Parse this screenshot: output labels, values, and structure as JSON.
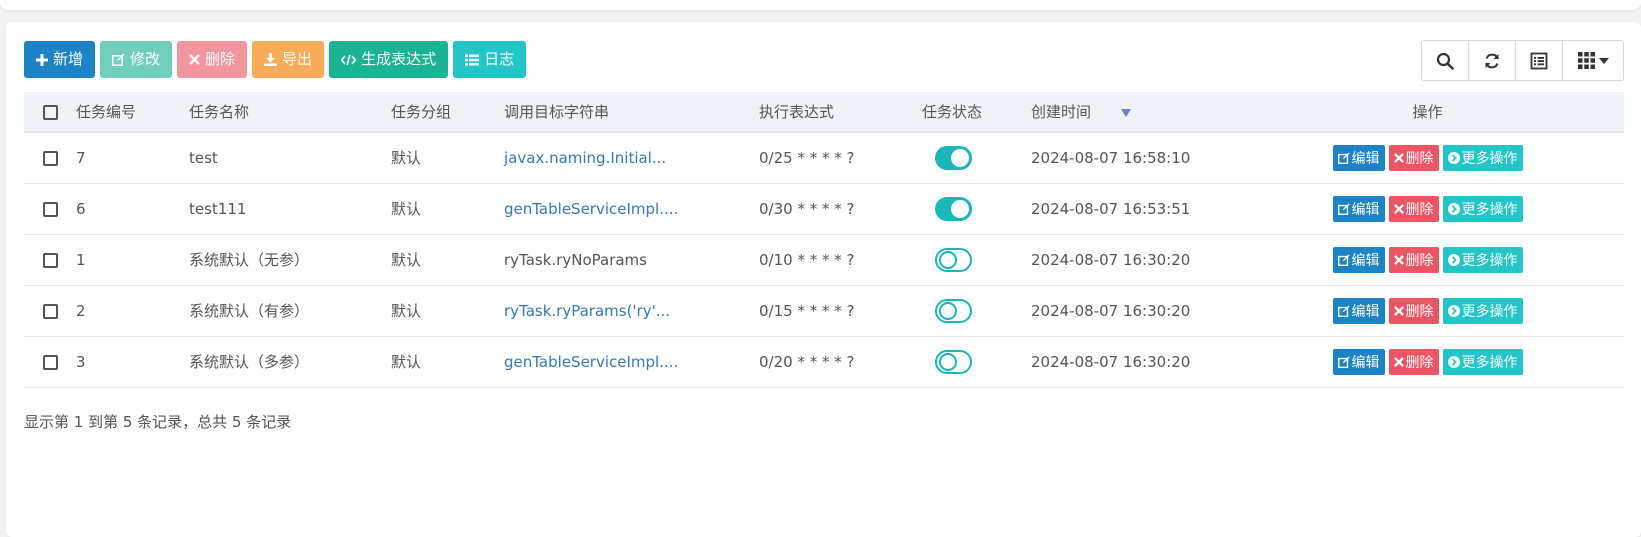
{
  "toolbar": {
    "add_label": "新增",
    "edit_label": "修改",
    "delete_label": "删除",
    "export_label": "导出",
    "cron_label": "生成表达式",
    "log_label": "日志"
  },
  "table": {
    "headers": {
      "id": "任务编号",
      "name": "任务名称",
      "group": "任务分组",
      "target": "调用目标字符串",
      "cron": "执行表达式",
      "status": "任务状态",
      "created": "创建时间",
      "ops": "操作"
    },
    "rows": [
      {
        "id": "7",
        "name": "test",
        "group": "默认",
        "target": "javax.naming.Initial...",
        "target_is_link": true,
        "cron": "0/25 * * * * ?",
        "status_on": true,
        "created": "2024-08-07 16:58:10"
      },
      {
        "id": "6",
        "name": "test111",
        "group": "默认",
        "target": "genTableServiceImpl....",
        "target_is_link": true,
        "cron": "0/30 * * * * ?",
        "status_on": true,
        "created": "2024-08-07 16:53:51"
      },
      {
        "id": "1",
        "name": "系统默认（无参）",
        "group": "默认",
        "target": "ryTask.ryNoParams",
        "target_is_link": false,
        "cron": "0/10 * * * * ?",
        "status_on": false,
        "created": "2024-08-07 16:30:20"
      },
      {
        "id": "2",
        "name": "系统默认（有参）",
        "group": "默认",
        "target": "ryTask.ryParams('ry'...",
        "target_is_link": true,
        "cron": "0/15 * * * * ?",
        "status_on": false,
        "created": "2024-08-07 16:30:20"
      },
      {
        "id": "3",
        "name": "系统默认（多参）",
        "group": "默认",
        "target": "genTableServiceImpl....",
        "target_is_link": true,
        "cron": "0/20 * * * * ?",
        "status_on": false,
        "created": "2024-08-07 16:30:20"
      }
    ],
    "row_ops": {
      "edit": "编辑",
      "delete": "删除",
      "more": "更多操作"
    }
  },
  "pagination": {
    "summary": "显示第 1 到第 5 条记录，总共 5 条记录"
  },
  "colors": {
    "primary": "#1c84c6",
    "success": "#1ab394",
    "danger": "#ed5565",
    "warning": "#f8ac59",
    "info": "#23c6c8",
    "link": "#337ab7"
  }
}
